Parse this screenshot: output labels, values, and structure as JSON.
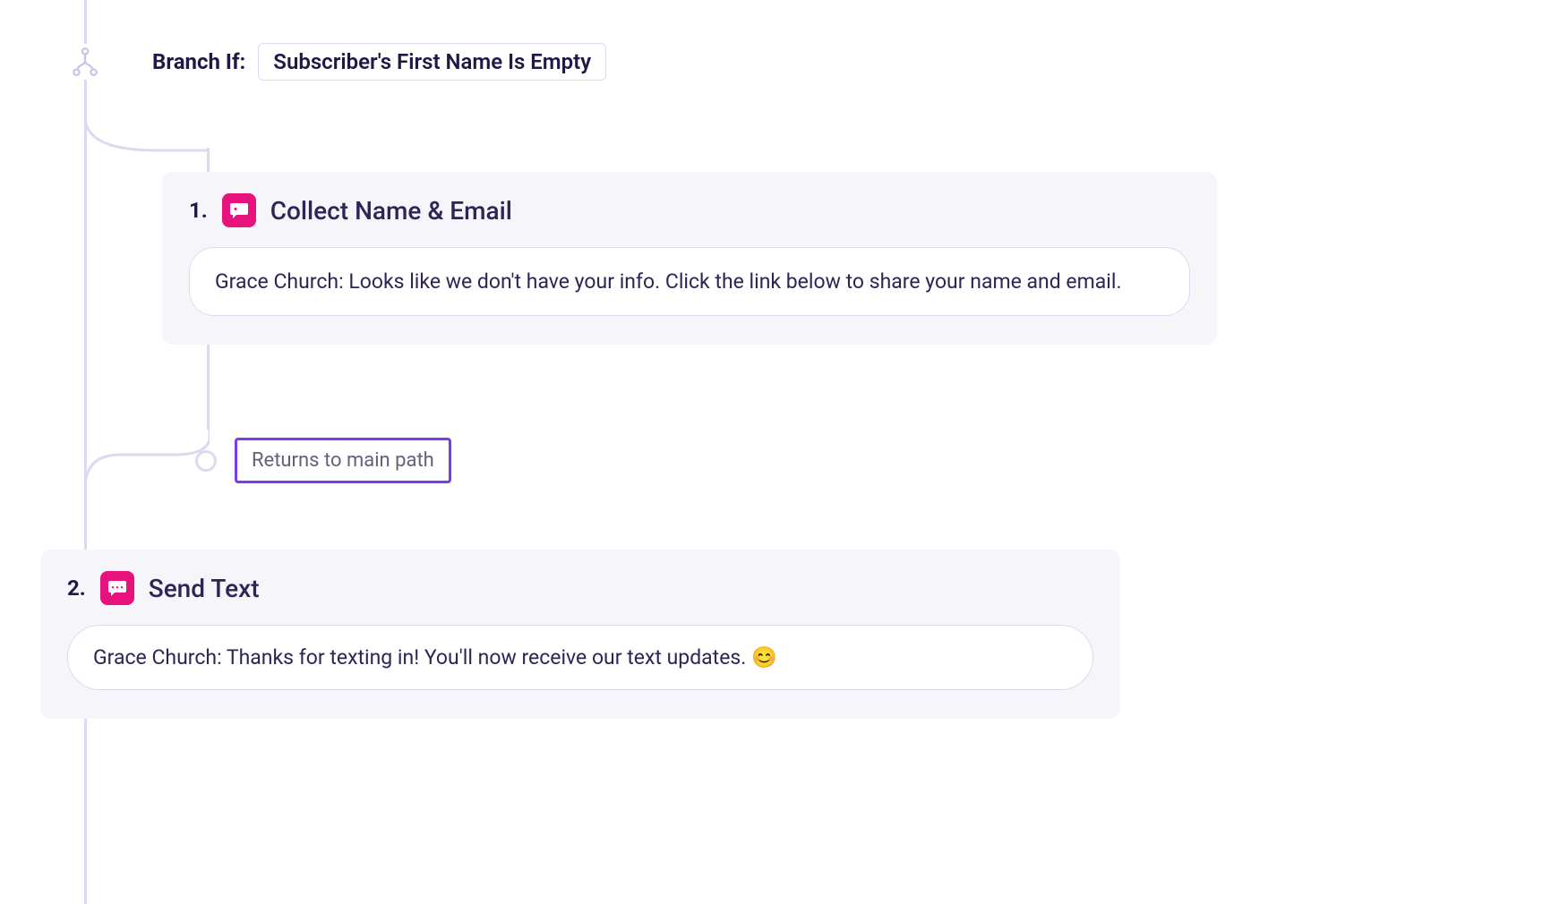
{
  "branch": {
    "label": "Branch If:",
    "condition": "Subscriber's First Name Is Empty"
  },
  "steps": {
    "s1": {
      "number": "1.",
      "title": "Collect Name & Email",
      "message": "Grace Church: Looks like we don't have your info. Click the link below to share your name and email."
    },
    "s2": {
      "number": "2.",
      "title": "Send Text",
      "message": "Grace Church: Thanks for texting in! You'll now receive our text updates. 😊"
    }
  },
  "return_label": "Returns to main path"
}
